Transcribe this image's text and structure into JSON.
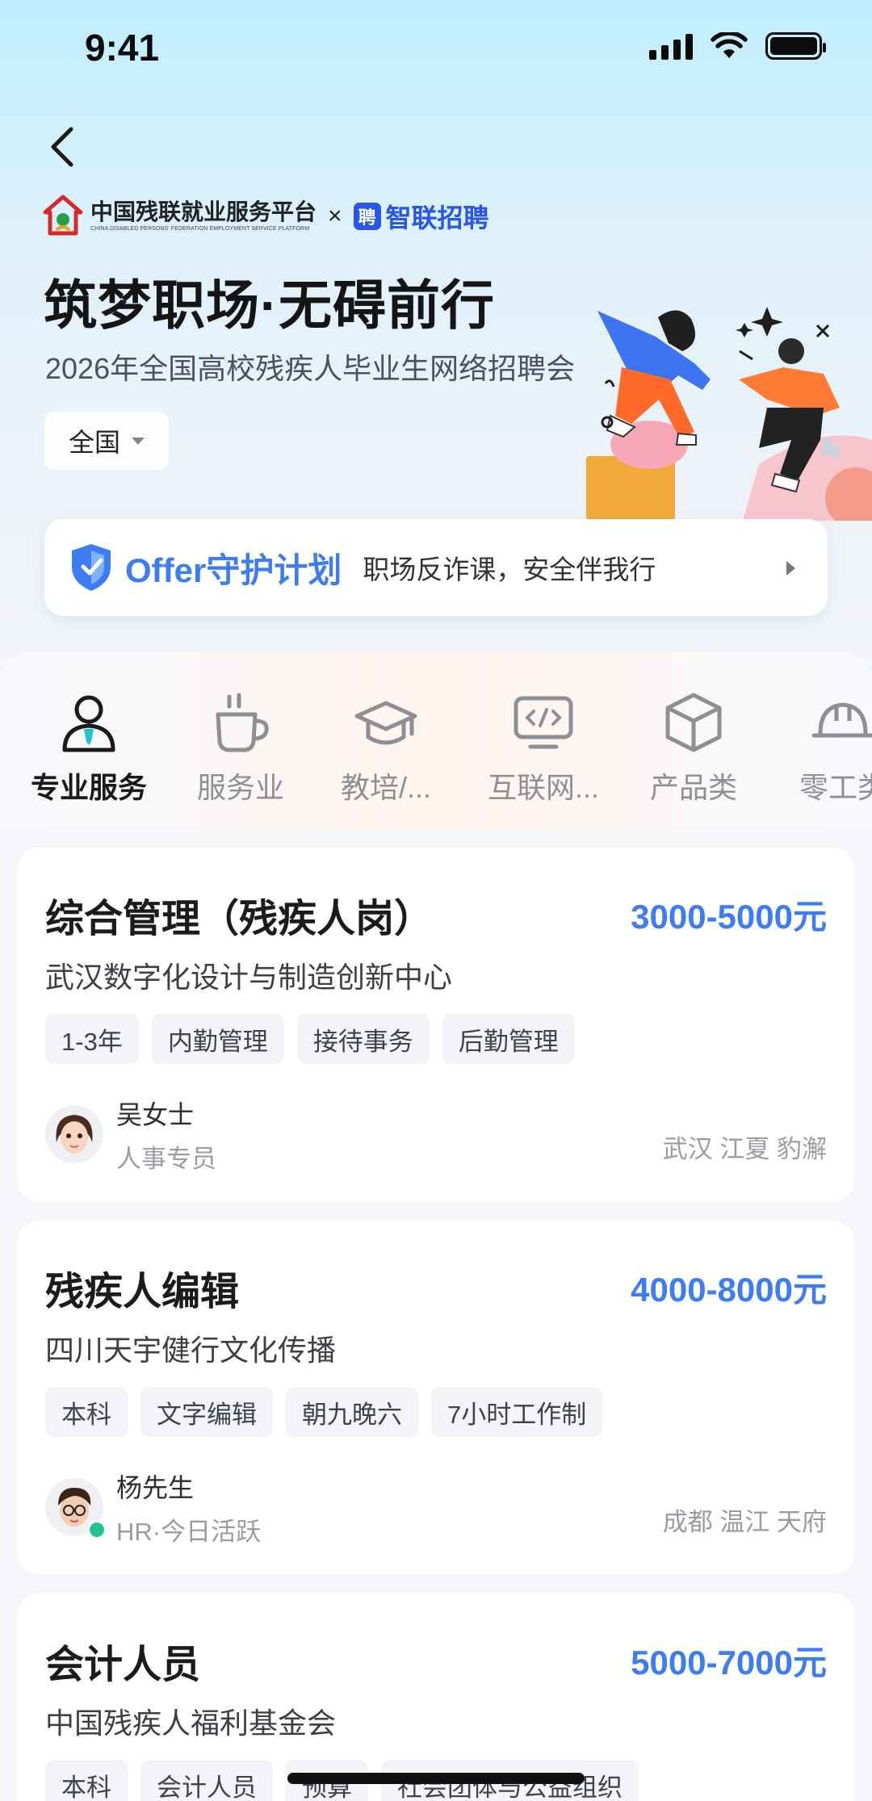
{
  "status_bar": {
    "time": "9:41"
  },
  "header": {
    "cdpf_name": "中国残联就业服务平台",
    "cdpf_en": "CHINA DISABLED PERSONS' FEDERATION EMPLOYMENT SERVICE PLATFORM",
    "times": "×",
    "zhilian_mark": "聘",
    "zhilian_name": "智联招聘",
    "title": "筑梦职场·无碍前行",
    "subtitle": "2026年全国高校残疾人毕业生网络招聘会",
    "region": "全国"
  },
  "offer_banner": {
    "title": "Offer守护计划",
    "description": "职场反诈课，安全伴我行"
  },
  "categories": [
    {
      "label": "专业服务",
      "icon": "user-tie-icon",
      "active": true
    },
    {
      "label": "服务业",
      "icon": "coffee-cup-icon",
      "active": false
    },
    {
      "label": "教培/...",
      "icon": "graduation-cap-icon",
      "active": false
    },
    {
      "label": "互联网...",
      "icon": "code-monitor-icon",
      "active": false
    },
    {
      "label": "产品类",
      "icon": "box-icon",
      "active": false
    },
    {
      "label": "零工类",
      "icon": "hard-hat-icon",
      "active": false
    }
  ],
  "jobs": [
    {
      "title": "综合管理（残疾人岗）",
      "salary": "3000-5000元",
      "company": "武汉数字化设计与制造创新中心",
      "tags": [
        "1-3年",
        "内勤管理",
        "接待事务",
        "后勤管理"
      ],
      "recruiter_name": "吴女士",
      "recruiter_role": "人事专员",
      "location": "武汉 江夏 豹澥"
    },
    {
      "title": "残疾人编辑",
      "salary": "4000-8000元",
      "company": "四川天宇健行文化传播",
      "tags": [
        "本科",
        "文字编辑",
        "朝九晚六",
        "7小时工作制"
      ],
      "recruiter_name": "杨先生",
      "recruiter_role": "HR·今日活跃",
      "location": "成都 温江 天府"
    },
    {
      "title": "会计人员",
      "salary": "5000-7000元",
      "company": "中国残疾人福利基金会",
      "tags": [
        "本科",
        "会计人员",
        "预算",
        "社会团体与公益组织"
      ],
      "recruiter_name": "",
      "recruiter_role": "",
      "location": ""
    }
  ],
  "colors": {
    "accent": "#3d7cf2",
    "online": "#20c38f"
  }
}
